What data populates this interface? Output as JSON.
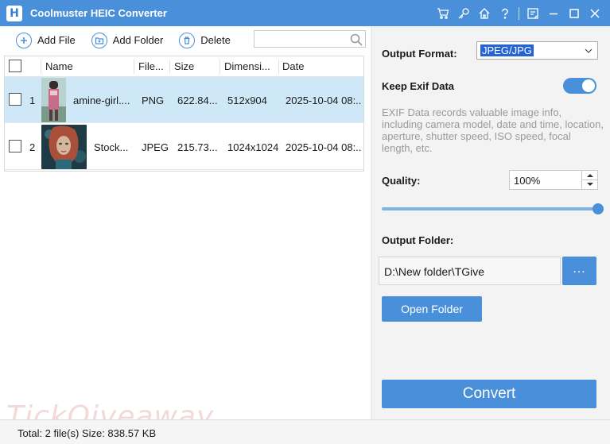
{
  "window": {
    "title": "Coolmuster HEIC Converter",
    "logo_letter": "H"
  },
  "title_icons": [
    "cart-icon",
    "key-icon",
    "home-icon",
    "help-icon",
    "feedback-icon",
    "minimize-icon",
    "maximize-icon",
    "close-icon"
  ],
  "toolbar": {
    "add_file": "Add File",
    "add_folder": "Add Folder",
    "delete": "Delete",
    "search_placeholder": ""
  },
  "table": {
    "columns": [
      "Name",
      "File...",
      "Size",
      "Dimensi...",
      "Date"
    ],
    "rows": [
      {
        "index": "1",
        "name": "amine-girl....",
        "type": "PNG",
        "size": "622.84...",
        "dimensions": "512x904",
        "date": "2025-10-04 08:...",
        "selected": true,
        "checked": false
      },
      {
        "index": "2",
        "name": "Stock...",
        "type": "JPEG",
        "size": "215.73...",
        "dimensions": "1024x1024",
        "date": "2025-10-04 08:...",
        "selected": false,
        "checked": false
      }
    ]
  },
  "settings": {
    "output_format_label": "Output Format:",
    "output_format_value": "JPEG/JPG",
    "keep_exif_label": "Keep Exif Data",
    "keep_exif_on": true,
    "exif_description": "EXIF Data records valuable image info, including camera model, date and time, location, aperture, shutter speed, ISO speed, focal length, etc.",
    "quality_label": "Quality:",
    "quality_value": "100%",
    "quality_percent": 100,
    "output_folder_label": "Output Folder:",
    "output_folder_value": "D:\\New folder\\TGive",
    "browse_label": "...",
    "open_folder_label": "Open Folder",
    "convert_label": "Convert"
  },
  "status": {
    "text": "Total: 2 file(s) Size: 838.57 KB"
  },
  "watermark": "TickQiveaway",
  "colors": {
    "accent": "#4a8fd9",
    "selected_row": "#cfe8f7",
    "panel_bg": "#f3f3f3"
  }
}
